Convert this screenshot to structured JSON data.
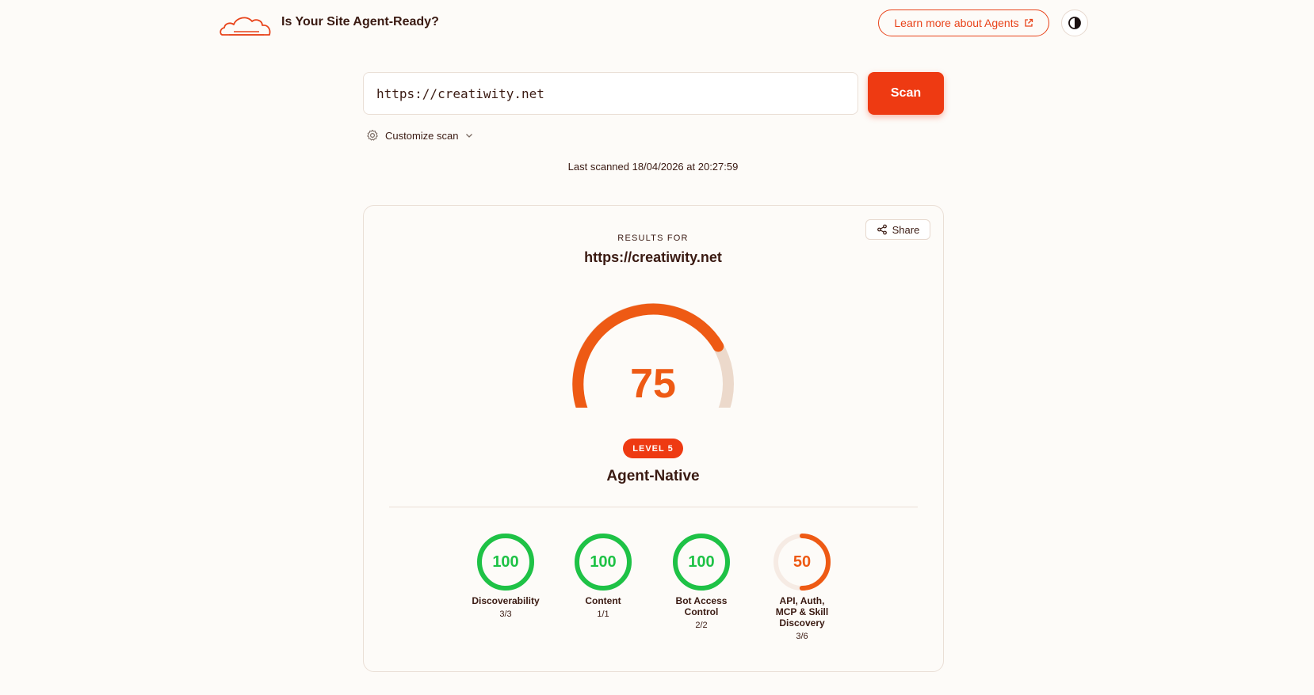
{
  "header": {
    "title": "Is Your Site Agent-Ready?",
    "learn_more_label": "Learn more about Agents"
  },
  "search": {
    "url_value": "https://creatiwity.net",
    "scan_label": "Scan",
    "customize_label": "Customize scan",
    "last_scanned": "Last scanned 18/04/2026 at 20:27:59"
  },
  "results": {
    "share_label": "Share",
    "results_for_label": "RESULTS FOR",
    "url": "https://creatiwity.net",
    "score": "75",
    "score_value": 75,
    "level_label": "LEVEL 5",
    "level_name": "Agent-Native"
  },
  "metrics": [
    {
      "value": "100",
      "percent": 100,
      "label": "Discoverability",
      "fraction": "3/3",
      "color": "#1ec246"
    },
    {
      "value": "100",
      "percent": 100,
      "label": "Content",
      "fraction": "1/1",
      "color": "#1ec246"
    },
    {
      "value": "100",
      "percent": 100,
      "label": "Bot Access Control",
      "fraction": "2/2",
      "color": "#1ec246"
    },
    {
      "value": "50",
      "percent": 50,
      "label": "API, Auth, MCP & Skill Discovery",
      "fraction": "3/6",
      "color": "#ee5a14"
    }
  ],
  "colors": {
    "accent": "#ee3a12",
    "gauge": "#ee5a14",
    "gauge_track": "#ecd9cb",
    "good": "#1ec246"
  },
  "icons": {
    "logo": "cloud-logo-icon",
    "external": "external-link-icon",
    "theme": "contrast-icon",
    "gear": "gear-icon",
    "chevron": "chevron-down-icon",
    "share": "share-icon"
  }
}
